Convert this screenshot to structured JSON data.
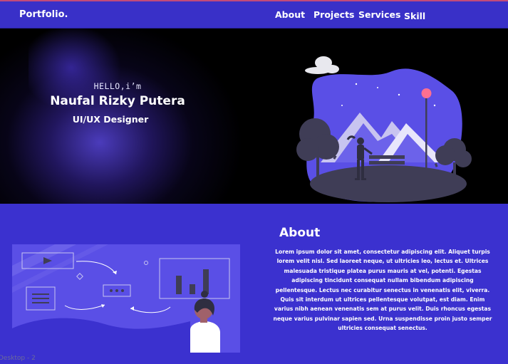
{
  "nav": {
    "brand": "Portfolio.",
    "links": [
      "About",
      "Projects",
      "Services",
      "Skill"
    ]
  },
  "hero": {
    "greeting": "HELLO,i’m",
    "name": "Naufal Rizky Putera",
    "role": "UI/UX Designer"
  },
  "about": {
    "title": "About",
    "body": "Lorem ipsum dolor sit amet, consectetur adipiscing elit. Aliquet turpis lorem velit nisl. Sed laoreet neque, ut ultricies leo, lectus et. Ultrices malesuada tristique platea purus mauris at vel, potenti. Egestas adipiscing tincidunt consequat nullam bibendum adipiscing pellentesque. Lectus nec curabitur senectus in venenatis elit, viverra. Quis sit interdum ut ultrices pellentesque volutpat, est diam. Enim varius nibh aenean venenatis sem at purus velit. Duis rhoncus egestas neque varius pulvinar sapien sed. Urna suspendisse proin justo semper ultricies consequat senectus."
  },
  "frame_label": "Desktop - 2",
  "colors": {
    "primary": "#3b31cf",
    "hero_bg": "#000000",
    "accent_pink": "#ff6f91"
  }
}
